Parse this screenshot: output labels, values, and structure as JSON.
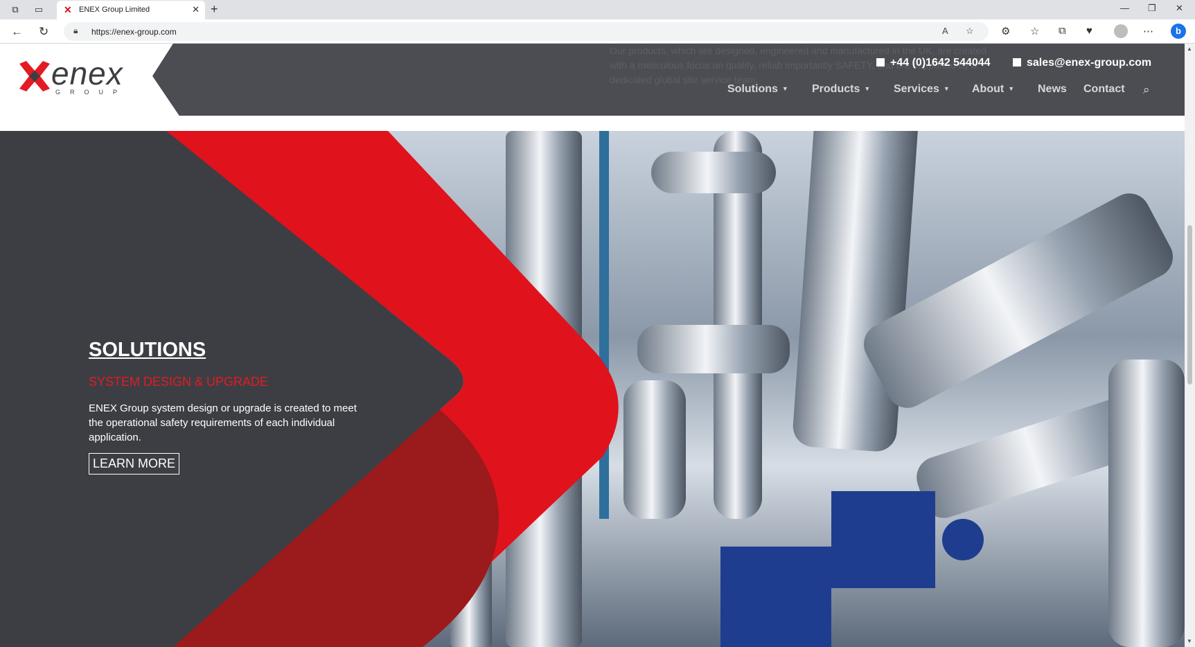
{
  "browser": {
    "tab_title": "ENEX Group Limited",
    "url": "https://enex-group.com"
  },
  "header": {
    "logo_text": "enex",
    "logo_sub": "GROUP",
    "phone": "+44 (0)1642 544044",
    "email": "sales@enex-group.com",
    "ghost_text": "Our products, which are designed, engineered and manufactured in the UK, are created with a meticulous focus on quality, reliab importantly SAFETY, and are supported by a dedicated global site service team.",
    "menu": [
      {
        "label": "Solutions",
        "dropdown": true
      },
      {
        "label": "Products",
        "dropdown": true
      },
      {
        "label": "Services",
        "dropdown": true
      },
      {
        "label": "About",
        "dropdown": true
      },
      {
        "label": "News",
        "dropdown": false
      },
      {
        "label": "Contact",
        "dropdown": false
      }
    ]
  },
  "hero": {
    "title": "SOLUTIONS",
    "subtitle": "SYSTEM DESIGN & UPGRADE",
    "description": "ENEX Group system design or upgrade is created to meet the operational safety requirements of each individual application.",
    "button": "LEARN MORE"
  },
  "colors": {
    "brand_red": "#e31b23",
    "dark_red": "#9b1a1b",
    "header_grey": "#4b4d52",
    "hero_dark": "#3d3e43"
  }
}
